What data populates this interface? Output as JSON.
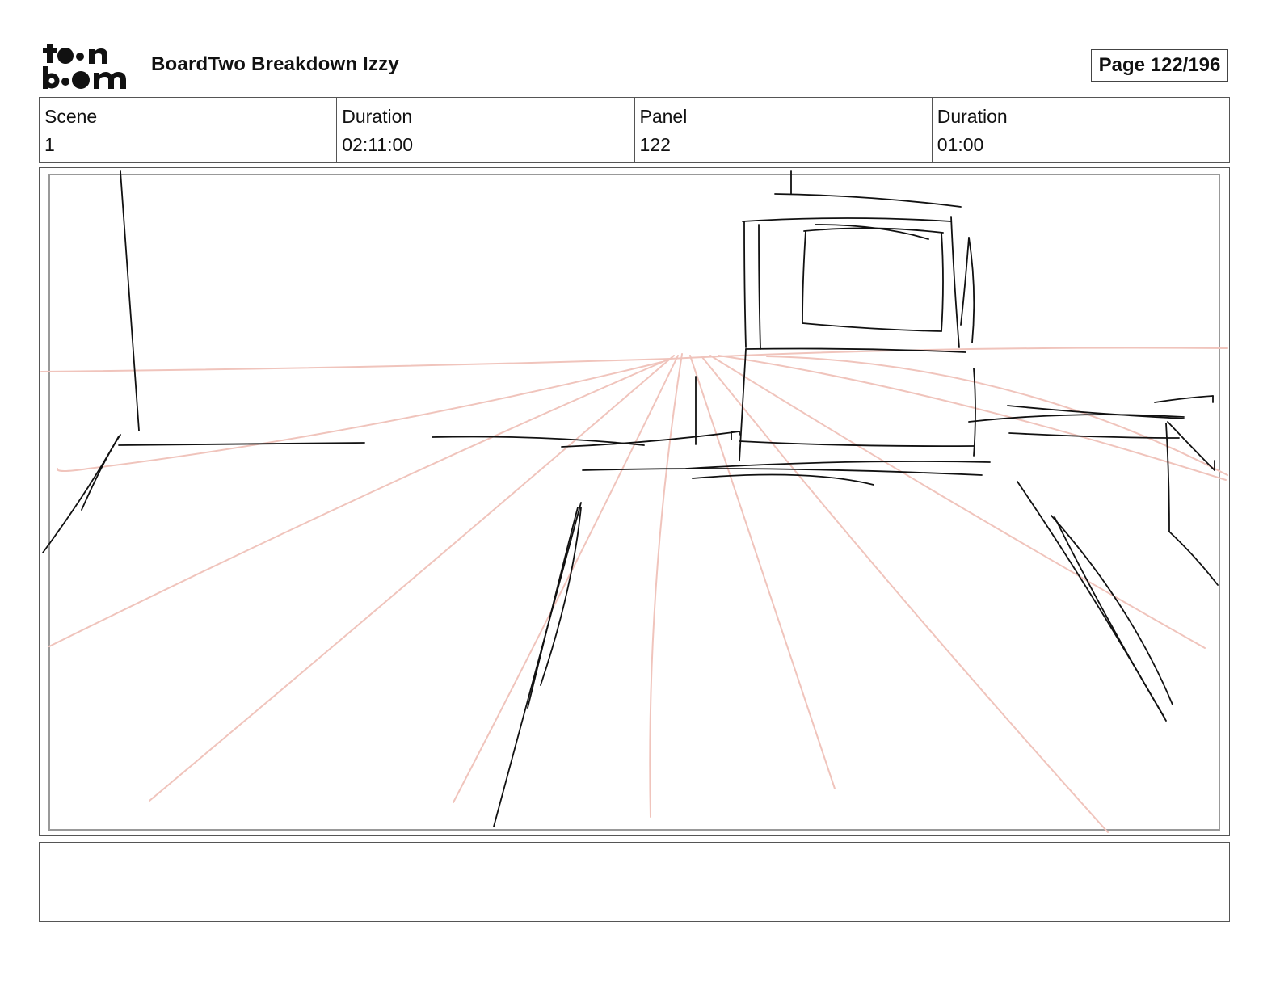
{
  "header": {
    "logo_line1": "toon",
    "logo_line2": "boom",
    "title": "BoardTwo Breakdown Izzy",
    "page": "Page 122/196"
  },
  "info": {
    "scene_label": "Scene",
    "scene_value": "1",
    "scene_duration_label": "Duration",
    "scene_duration_value": "02:11:00",
    "panel_label": "Panel",
    "panel_value": "122",
    "panel_duration_label": "Duration",
    "panel_duration_value": "01:00"
  },
  "notes": {
    "text": ""
  },
  "colors": {
    "sketch_ink": "#111111",
    "perspective_guides": "#f0c4bc",
    "frame_border": "#555555"
  }
}
